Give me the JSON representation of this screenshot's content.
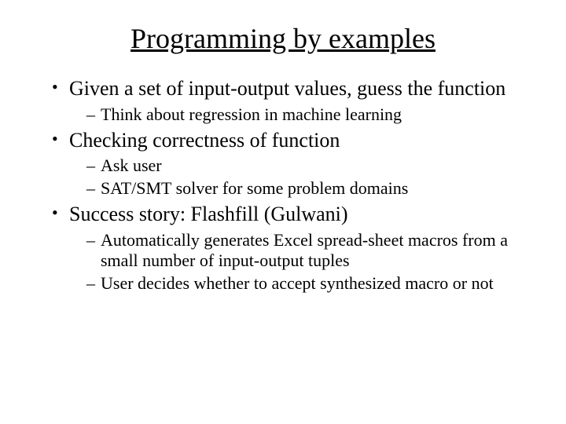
{
  "title": "Programming by examples",
  "bullets": [
    {
      "text": "Given a set of input-output values, guess the function",
      "subs": [
        "Think about regression in machine learning"
      ]
    },
    {
      "text": "Checking correctness of function",
      "subs": [
        "Ask user",
        "SAT/SMT solver for some problem domains"
      ]
    },
    {
      "text": "Success story: Flashfill (Gulwani)",
      "subs": [
        "Automatically generates Excel spread-sheet macros from a small number of input-output tuples",
        "User decides whether to accept synthesized macro or not"
      ]
    }
  ]
}
